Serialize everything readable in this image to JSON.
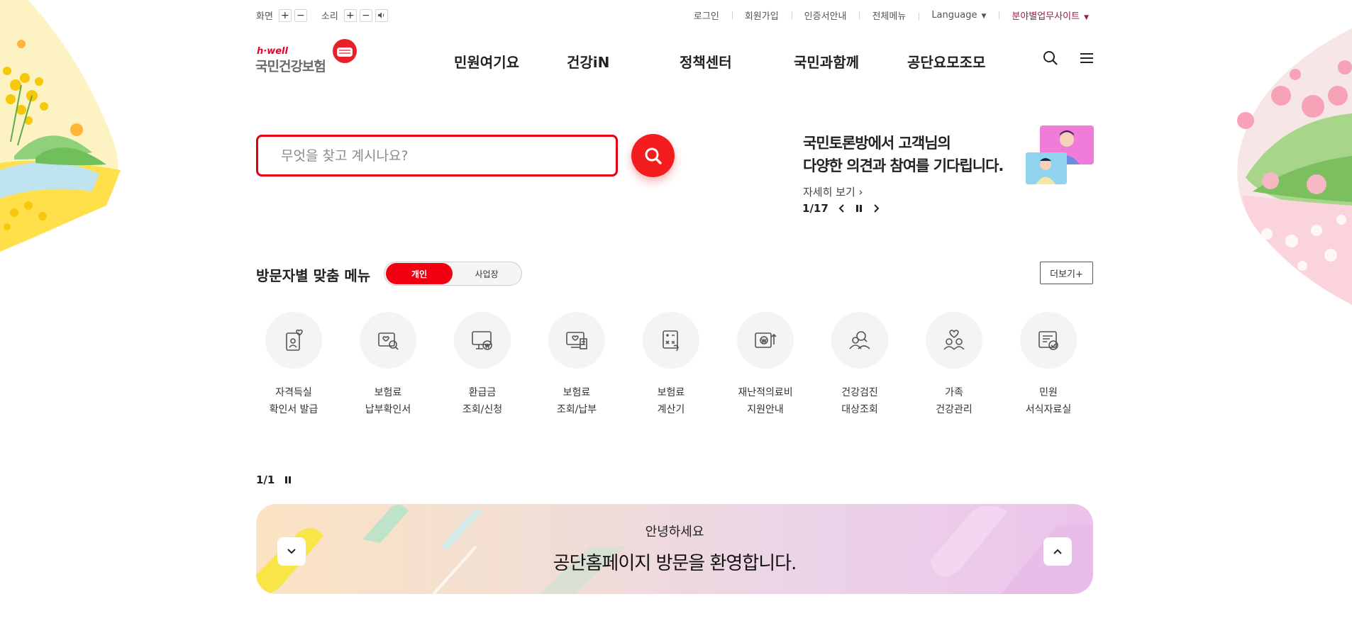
{
  "util": {
    "screen_label": "화면",
    "sound_label": "소리",
    "plus": "+",
    "minus": "−",
    "links": [
      "로그인",
      "회원가입",
      "인증서안내",
      "전체메뉴"
    ],
    "language": "Language",
    "related_sites": "분야별업무사이트"
  },
  "logo": {
    "sub": "h·well",
    "main": "국민건강보험"
  },
  "gnb": [
    "민원여기요",
    "건강iN",
    "정책센터",
    "국민과함께",
    "공단요모조모"
  ],
  "search": {
    "placeholder": "무엇을 찾고 계시나요?"
  },
  "promo": {
    "line1": "국민토론방에서 고객님의",
    "line2": "다양한 의견과 참여를 기다립니다.",
    "more": "자세히 보기",
    "current": "1",
    "total": "17"
  },
  "visitor_menu": {
    "title": "방문자별 맞춤 메뉴",
    "tabs": [
      "개인",
      "사업장"
    ],
    "active_tab": "개인",
    "more_label": "더보기+",
    "items": [
      {
        "line1": "자격득실",
        "line2": "확인서 발급",
        "icon": "id-card-heart-icon"
      },
      {
        "line1": "보험료",
        "line2": "납부확인서",
        "icon": "document-search-icon"
      },
      {
        "line1": "환급금",
        "line2": "조회/신청",
        "icon": "monitor-won-icon"
      },
      {
        "line1": "보험료",
        "line2": "조회/납부",
        "icon": "monitor-receipt-icon"
      },
      {
        "line1": "보험료",
        "line2": "계산기",
        "icon": "calculator-hand-icon"
      },
      {
        "line1": "재난적의료비",
        "line2": "지원안내",
        "icon": "wallet-won-icon"
      },
      {
        "line1": "건강검진",
        "line2": "대상조회",
        "icon": "people-search-icon"
      },
      {
        "line1": "가족",
        "line2": "건강관리",
        "icon": "family-heart-icon"
      },
      {
        "line1": "민원",
        "line2": "서식자료실",
        "icon": "form-check-icon"
      }
    ],
    "pager": "1/1"
  },
  "banner": {
    "line1": "안녕하세요",
    "line2": "공단홈페이지 방문을 환영합니다."
  },
  "colors": {
    "brand_red": "#e60012",
    "brand_dark_red": "#9c1d42"
  }
}
